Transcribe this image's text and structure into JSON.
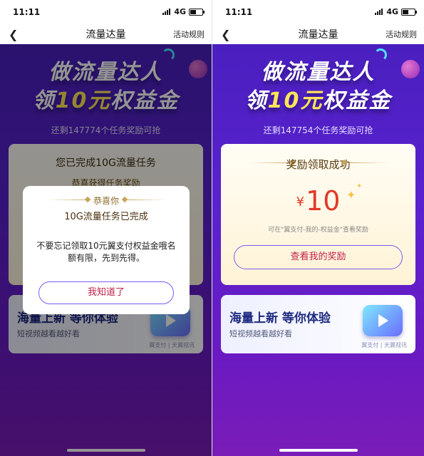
{
  "status": {
    "time": "11:11",
    "network": "4G"
  },
  "nav": {
    "title": "流量达量",
    "rules": "活动规则",
    "back_icon": "chevron-left-icon"
  },
  "hero": {
    "line1": "做流量达人",
    "line2_a": "领",
    "line2_hl": "10元",
    "line2_b": "权益金"
  },
  "left": {
    "remaining": "还剩147774个任务奖励可抢",
    "card_title": "您已完成10G流量任务",
    "card_subtitle": "恭喜获得任务奖励",
    "dialog": {
      "top": "恭喜你",
      "title": "10G流量任务已完成",
      "message": "不要忘记领取10元翼支付权益金哦名额有限，先到先得。",
      "button": "我知道了"
    },
    "video_card": {
      "title": "海量上新 等你体验",
      "subtitle": "短视频越看越好看",
      "brand": "翼支付 | 天翼视讯"
    }
  },
  "right": {
    "remaining": "还剩147754个任务奖励可抢",
    "reward": {
      "title": "奖励领取成功",
      "currency": "¥",
      "amount": "10",
      "note": "可在\"翼支付-我的-权益金\"查看奖励",
      "button": "查看我的奖励"
    },
    "video_card": {
      "title": "海量上新 等你体验",
      "subtitle": "短视频越看越好看",
      "brand": "翼支付 | 天翼视讯"
    }
  },
  "colors": {
    "primary_purple": "#5a22cf",
    "accent_red": "#c0204a",
    "gold": "#c9a45a",
    "amount_red": "#e03a2a"
  }
}
